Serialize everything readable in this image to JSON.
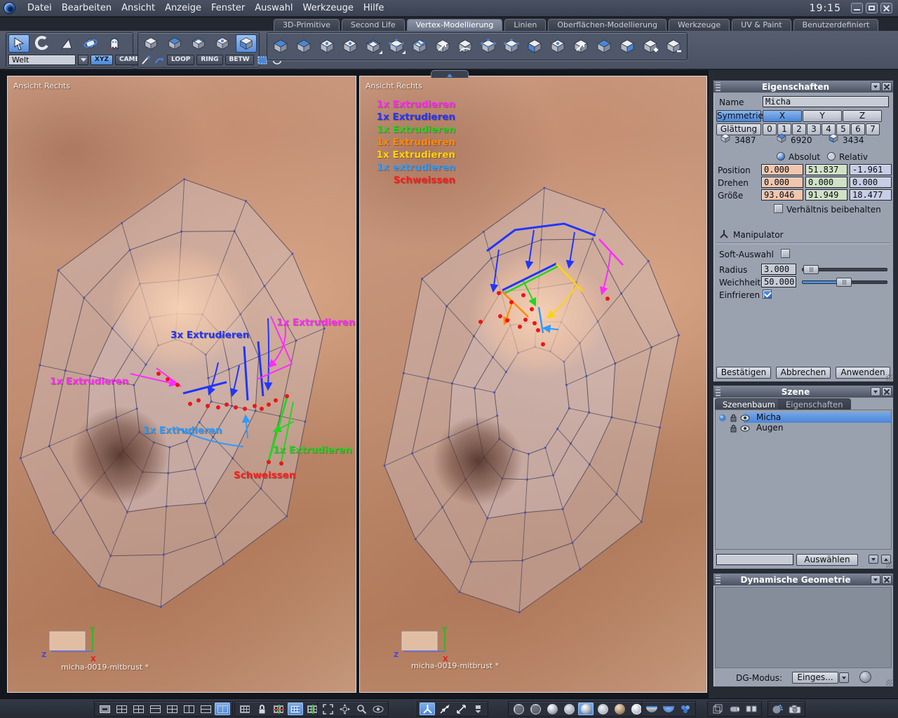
{
  "titlebar": {
    "time": "19:15"
  },
  "menu": {
    "items": [
      "Datei",
      "Bearbeiten",
      "Ansicht",
      "Anzeige",
      "Fenster",
      "Auswahl",
      "Werkzeuge",
      "Hilfe"
    ]
  },
  "ribbon_tabs": [
    {
      "label": "3D-Primitive",
      "active": false
    },
    {
      "label": "Second Life",
      "active": false
    },
    {
      "label": "Vertex-Modellierung",
      "active": true
    },
    {
      "label": "Linien",
      "active": false
    },
    {
      "label": "Oberflächen-Modellierung",
      "active": false
    },
    {
      "label": "Werkzeuge",
      "active": false
    },
    {
      "label": "UV & Paint",
      "active": false
    },
    {
      "label": "Benutzerdefiniert",
      "active": false
    }
  ],
  "toolbar": {
    "space_selector": "Welt",
    "xyz_label": "XYZ",
    "camera_label": "CAMERA",
    "loop_label": "LOOP",
    "ring_label": "RING",
    "betw_label": "BETW"
  },
  "colors": {
    "magenta": "#ff2bff",
    "blue": "#2036ff",
    "green": "#23d523",
    "orange": "#ff8800",
    "yellow": "#ffd400",
    "cyan": "#2e9bff",
    "red": "#ff1d1d",
    "accent": "#4a86d8"
  },
  "viewport_left": {
    "label": "Ansicht Rechts",
    "file_label": "micha-0019-mitbrust *",
    "annotations": [
      {
        "text": "1x Extrudieren",
        "color": "magenta"
      },
      {
        "text": "3x Extrudieren",
        "color": "blue"
      },
      {
        "text": "1x Extrudieren",
        "color": "magenta"
      },
      {
        "text": "1x Extrudieren",
        "color": "cyan"
      },
      {
        "text": "1x Extrudieren",
        "color": "green"
      },
      {
        "text": "Schweissen",
        "color": "red"
      }
    ]
  },
  "viewport_right": {
    "label": "Ansicht Rechts",
    "file_label": "micha-0019-mitbrust *",
    "legend": [
      {
        "text": "1x Extrudieren",
        "color": "magenta"
      },
      {
        "text": "1x Extrudieren",
        "color": "blue"
      },
      {
        "text": "1x Extrudieren",
        "color": "green"
      },
      {
        "text": "1x Extrudieren",
        "color": "orange"
      },
      {
        "text": "1x Extrudieren",
        "color": "yellow"
      },
      {
        "text": "1x extrudieren",
        "color": "cyan"
      },
      {
        "text": "Schweissen",
        "color": "red"
      }
    ]
  },
  "axis_gizmo": {
    "x": "X",
    "y": "Y",
    "z": "Z"
  },
  "properties": {
    "title": "Eigenschaften",
    "name_label": "Name",
    "name_value": "Micha",
    "symmetry_label": "Symmetrie",
    "sym_x": "X",
    "sym_y": "Y",
    "sym_z": "Z",
    "smoothing_label": "Glättung",
    "smoothing_levels": [
      "0",
      "1",
      "2",
      "3",
      "4",
      "5",
      "6",
      "7"
    ],
    "vertex_count": "3487",
    "edge_count": "6920",
    "face_count": "3434",
    "mode_absolute": "Absolut",
    "mode_relative": "Relativ",
    "position_label": "Position",
    "position": [
      "0.000",
      "51.837",
      "-1.961"
    ],
    "rotation_label": "Drehen",
    "rotation": [
      "0.000",
      "0.000",
      "0.000"
    ],
    "size_label": "Größe",
    "size": [
      "93.046",
      "91.949",
      "18.477"
    ],
    "keep_ratio_label": "Verhältnis beibehalten",
    "manipulator_label": "Manipulator",
    "soft_select_label": "Soft-Auswahl",
    "radius_label": "Radius",
    "radius_value": "3.000",
    "softness_label": "Weichheit",
    "softness_value": "50.000",
    "freeze_label": "Einfrieren",
    "confirm_label": "Bestätigen",
    "cancel_label": "Abbrechen",
    "apply_label": "Anwenden"
  },
  "scene": {
    "title": "Szene",
    "tab_tree": "Szenenbaum",
    "tab_props": "Eigenschaften",
    "items": [
      {
        "name": "Micha",
        "selected": true
      },
      {
        "name": "Augen",
        "selected": false
      }
    ],
    "select_button": "Auswählen",
    "filter_value": ""
  },
  "dyn_geometry": {
    "title": "Dynamische Geometrie",
    "mode_label": "DG-Modus:",
    "mode_value": "Einges..."
  }
}
